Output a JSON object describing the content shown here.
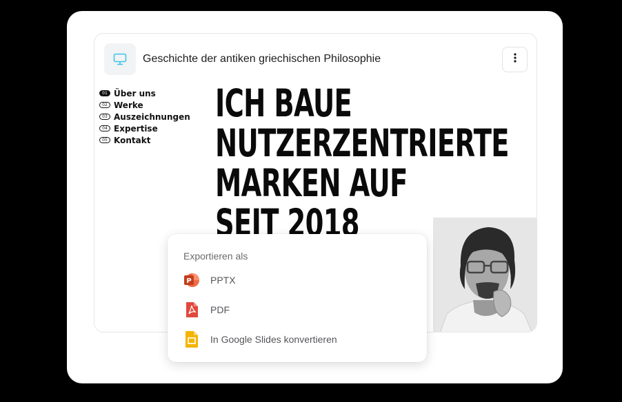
{
  "slide": {
    "title": "Geschichte der antiken griechischen Philosophie",
    "title_icon": "monitor-icon",
    "menu_icon": "more-vertical-icon"
  },
  "nav": {
    "items": [
      {
        "num": "01",
        "label": "Über uns",
        "active": true
      },
      {
        "num": "02",
        "label": "Werke",
        "active": false
      },
      {
        "num": "03",
        "label": "Auszeichnungen",
        "active": false
      },
      {
        "num": "04",
        "label": "Expertise",
        "active": false
      },
      {
        "num": "05",
        "label": "Kontakt",
        "active": false
      }
    ]
  },
  "headline": {
    "lines": [
      "ICH BAUE",
      "NUTZERZENTRIERTE",
      "MARKEN AUF",
      "SEIT 2018"
    ]
  },
  "export": {
    "heading": "Exportieren als",
    "options": [
      {
        "label": "PPTX",
        "icon": "powerpoint-icon"
      },
      {
        "label": "PDF",
        "icon": "pdf-icon"
      },
      {
        "label": "In Google Slides konvertieren",
        "icon": "google-slides-icon"
      }
    ]
  },
  "colors": {
    "accent_icon": "#3ec3e8",
    "powerpoint": "#d35230",
    "pdf": "#e2483d",
    "google_slides": "#f4b400"
  }
}
